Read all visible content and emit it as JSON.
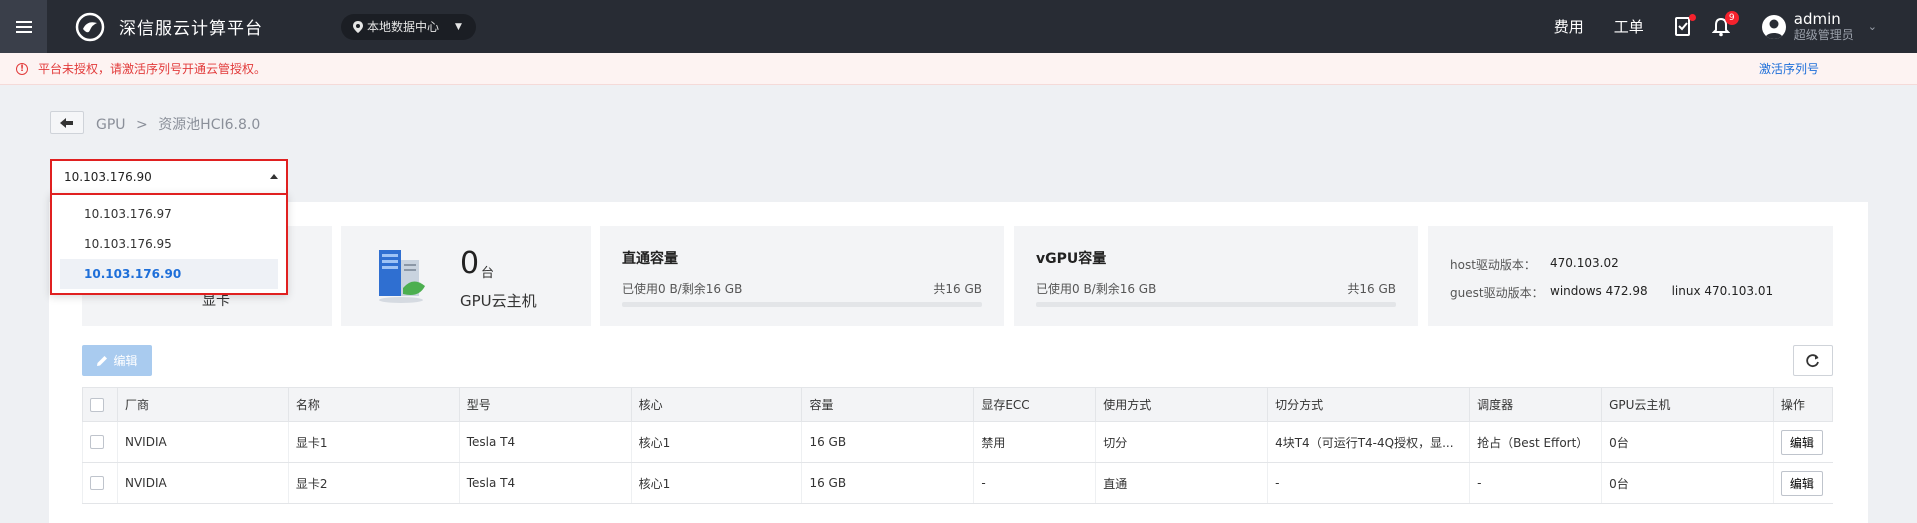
{
  "header": {
    "brand": "深信服云计算平台",
    "datacenter": "本地数据中心",
    "links": {
      "fees": "费用",
      "tickets": "工单"
    },
    "notification_count": "9",
    "user_name": "admin",
    "user_role": "超级管理员"
  },
  "warning": {
    "text": "平台未授权，请激活序列号开通云管授权。",
    "link": "激活序列号"
  },
  "breadcrumb": {
    "root": "GPU",
    "separator": ">",
    "current": "资源池HCI6.8.0"
  },
  "host_select": {
    "value": "10.103.176.90",
    "options": [
      "10.103.176.97",
      "10.103.176.95",
      "10.103.176.90"
    ],
    "selected_index": 2
  },
  "summary": {
    "card_label": "显卡",
    "gpu_vm_count": "0",
    "gpu_vm_unit": "台",
    "gpu_vm_label": "GPU云主机",
    "direct": {
      "title": "直通容量",
      "used": "已使用0 B/剩余16 GB",
      "total": "共16 GB",
      "used_fraction": 0
    },
    "vgpu": {
      "title": "vGPU容量",
      "used": "已使用0 B/剩余16 GB",
      "total": "共16 GB",
      "used_fraction": 0
    },
    "driver": {
      "host_label": "host驱动版本：",
      "host_value": "470.103.02",
      "guest_label": "guest驱动版本：",
      "guest_windows": "windows 472.98",
      "guest_linux": "linux 470.103.01"
    }
  },
  "toolbar": {
    "edit_label": "编辑"
  },
  "table": {
    "columns": [
      "厂商",
      "名称",
      "型号",
      "核心",
      "容量",
      "显存ECC",
      "使用方式",
      "切分方式",
      "调度器",
      "GPU云主机",
      "操作"
    ],
    "rows": [
      {
        "vendor": "NVIDIA",
        "name": "显卡1",
        "model": "Tesla T4",
        "core": "核心1",
        "capacity": "16 GB",
        "ecc": "禁用",
        "usage": "切分",
        "split": "4块T4（可运行T4-4Q授权，显...",
        "scheduler": "抢占（Best Effort）",
        "vms": "0台",
        "action": "编辑"
      },
      {
        "vendor": "NVIDIA",
        "name": "显卡2",
        "model": "Tesla T4",
        "core": "核心1",
        "capacity": "16 GB",
        "ecc": "-",
        "usage": "直通",
        "split": "-",
        "scheduler": "-",
        "vms": "0台",
        "action": "编辑"
      }
    ]
  },
  "colors": {
    "topbar": "#282c34",
    "accent": "#1e6fd9",
    "warning": "#e23b3b",
    "highlight_border": "#e02020"
  }
}
